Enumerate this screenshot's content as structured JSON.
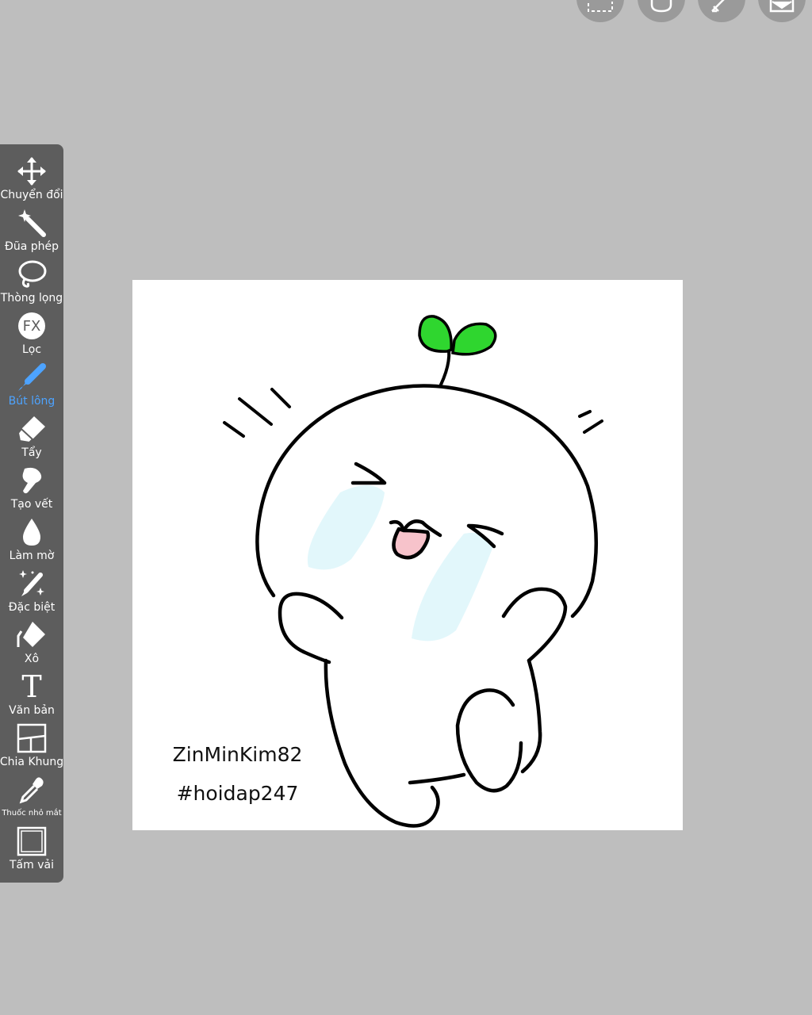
{
  "toolbar": {
    "items": [
      {
        "label": "Chuyển đổi",
        "icon": "move-icon"
      },
      {
        "label": "Đũa phép",
        "icon": "magic-wand-icon"
      },
      {
        "label": "Thòng lọng",
        "icon": "lasso-icon"
      },
      {
        "label": "Lọc",
        "icon": "fx-filter-icon"
      },
      {
        "label": "Bút lông",
        "icon": "brush-icon",
        "active": true
      },
      {
        "label": "Tẩy",
        "icon": "eraser-icon"
      },
      {
        "label": "Tạo vết",
        "icon": "smudge-icon"
      },
      {
        "label": "Làm mờ",
        "icon": "blur-drop-icon"
      },
      {
        "label": "Đặc biệt",
        "icon": "sparkle-pen-icon"
      },
      {
        "label": "Xô",
        "icon": "bucket-icon"
      },
      {
        "label": "Văn bản",
        "icon": "text-icon"
      },
      {
        "label": "Chia Khung",
        "icon": "frame-divide-icon"
      },
      {
        "label": "Thuốc nhỏ mắt",
        "icon": "eyedropper-icon"
      },
      {
        "label": "Tấm vải",
        "icon": "canvas-icon"
      }
    ],
    "fx_glyph": "FX",
    "text_glyph": "T"
  },
  "canvas": {
    "watermark_line1": "ZinMinKim82",
    "watermark_line2": "#hoidap247"
  },
  "colors": {
    "background": "#bebebe",
    "toolbar": "#5d5d5d",
    "active": "#4da3ff",
    "sprout": "#2fd62f",
    "tears": "#e2f7fb",
    "tongue": "#f7c3cb"
  }
}
